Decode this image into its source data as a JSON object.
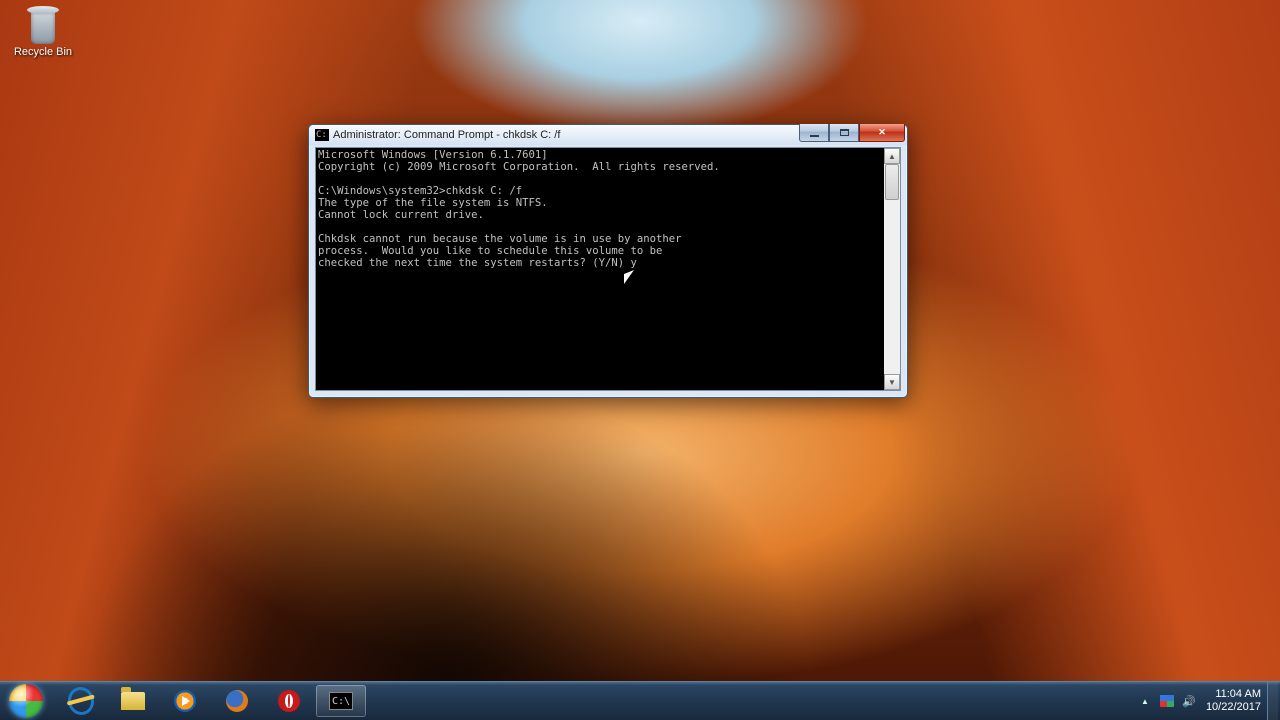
{
  "desktop": {
    "icons": {
      "recycle_bin": "Recycle Bin"
    }
  },
  "window": {
    "title": "Administrator: Command Prompt - chkdsk  C: /f",
    "controls": {
      "minimize": "Minimize",
      "maximize": "Maximize",
      "close": "Close"
    },
    "terminal_output": "Microsoft Windows [Version 6.1.7601]\nCopyright (c) 2009 Microsoft Corporation.  All rights reserved.\n\nC:\\Windows\\system32>chkdsk C: /f\nThe type of the file system is NTFS.\nCannot lock current drive.\n\nChkdsk cannot run because the volume is in use by another\nprocess.  Would you like to schedule this volume to be\nchecked the next time the system restarts? (Y/N) y"
  },
  "taskbar": {
    "start": "Start",
    "pinned": [
      {
        "name": "Internet Explorer"
      },
      {
        "name": "Windows Explorer"
      },
      {
        "name": "Windows Media Player"
      },
      {
        "name": "Firefox"
      },
      {
        "name": "Opera"
      }
    ],
    "running": [
      {
        "name": "Command Prompt"
      }
    ],
    "tray": {
      "show_hidden": "Show hidden icons",
      "action_center": "Action Center",
      "volume": "Volume",
      "time": "11:04 AM",
      "date": "10/22/2017",
      "show_desktop": "Show desktop"
    }
  }
}
